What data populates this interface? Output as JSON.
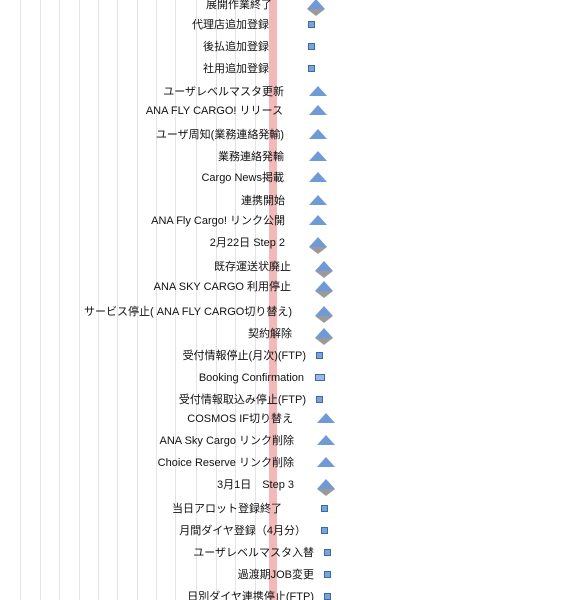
{
  "tasks": [
    {
      "label": "展開作業終了",
      "marker": "diamond"
    },
    {
      "label": "代理店追加登録",
      "marker": "square"
    },
    {
      "label": "後払追加登録",
      "marker": "square"
    },
    {
      "label": "社用追加登録",
      "marker": "square"
    },
    {
      "label": "ユーザレベルマスタ更新",
      "marker": "triangle"
    },
    {
      "label": "ANA FLY CARGO! リリース",
      "marker": "triangle"
    },
    {
      "label": "ユーザ周知(業務連絡発輸)",
      "marker": "triangle"
    },
    {
      "label": "業務連絡発輸",
      "marker": "triangle"
    },
    {
      "label": "Cargo News掲載",
      "marker": "triangle"
    },
    {
      "label": "連携開始",
      "marker": "triangle"
    },
    {
      "label": "ANA Fly Cargo! リンク公開",
      "marker": "triangle"
    },
    {
      "label": "2月22日 Step 2",
      "marker": "diamond"
    },
    {
      "label": "既存運送状廃止",
      "marker": "diamond"
    },
    {
      "label": "ANA SKY CARGO 利用停止",
      "marker": "diamond"
    },
    {
      "label": "サービス停止( ANA FLY CARGO切り替え)",
      "marker": "diamond"
    },
    {
      "label": "契約解除",
      "marker": "diamond"
    },
    {
      "label": "受付情報停止(月次)(FTP)",
      "marker": "square"
    },
    {
      "label": "Booking Confirmation",
      "marker": "rect"
    },
    {
      "label": "受付情報取込み停止(FTP)",
      "marker": "square"
    },
    {
      "label": "COSMOS IF切り替え",
      "marker": "triangle"
    },
    {
      "label": "ANA Sky Cargo リンク削除",
      "marker": "triangle"
    },
    {
      "label": "Choice Reserve リンク削除",
      "marker": "triangle"
    },
    {
      "label": "3月1日　Step 3",
      "marker": "diamond"
    },
    {
      "label": "当日アロット登録終了",
      "marker": "square"
    },
    {
      "label": "月間ダイヤ登録（4月分）",
      "marker": "square"
    },
    {
      "label": "ユーザレベルマスタ入替",
      "marker": "square"
    },
    {
      "label": "過渡期JOB変更",
      "marker": "square"
    },
    {
      "label": "日別ダイヤ連携停止(FTP)",
      "marker": "square"
    }
  ],
  "colors": {
    "today_line": "#f3b8b8",
    "milestone": "#6f9ad6",
    "grid": "#e4e4e4"
  }
}
